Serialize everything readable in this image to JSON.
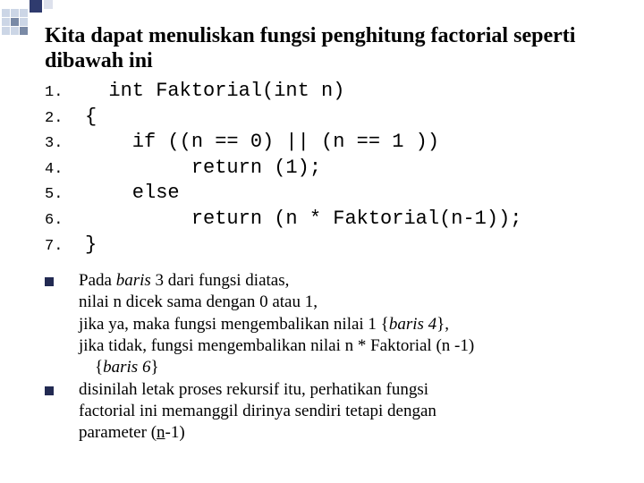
{
  "title": "Kita dapat menuliskan fungsi penghitung factorial seperti dibawah ini",
  "code": {
    "lines": [
      {
        "n": "1.",
        "text": "  int Faktorial(int n)"
      },
      {
        "n": "2.",
        "text": "{"
      },
      {
        "n": "3.",
        "text": "    if ((n == 0) || (n == 1 ))"
      },
      {
        "n": "4.",
        "text": "         return (1);"
      },
      {
        "n": "5.",
        "text": "    else"
      },
      {
        "n": "6.",
        "text": "         return (n * Faktorial(n-1));"
      },
      {
        "n": "7.",
        "text": "}"
      }
    ]
  },
  "notes": [
    {
      "pre1": "Pada ",
      "ital1": "baris",
      "mid1": " 3 dari fungsi diatas,",
      "line2": "nilai n dicek sama dengan 0 atau 1,",
      "line3a": "jika ya, maka fungsi mengembalikan nilai 1 {",
      "line3i": "baris 4",
      "line3b": "},",
      "line4": "jika tidak, fungsi mengembalikan nilai n * Faktorial (n -1)",
      "line5a": "{",
      "line5i": "baris 6",
      "line5b": "}"
    },
    {
      "line1": "disinilah letak proses rekursif itu, perhatikan fungsi",
      "line2": "factorial ini memanggil dirinya sendiri tetapi dengan",
      "line3a": "parameter (",
      "line3u": "n",
      "line3b": "-1)"
    }
  ]
}
